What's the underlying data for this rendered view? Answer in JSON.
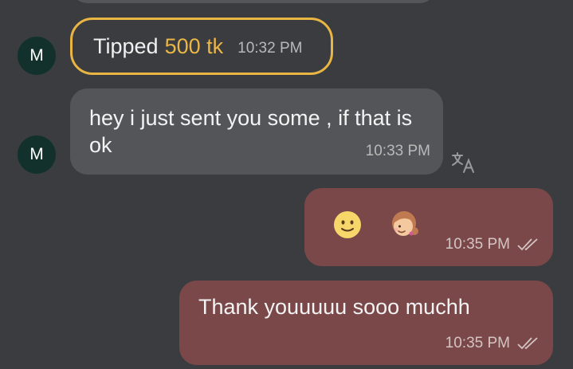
{
  "messages": {
    "tip": {
      "avatar_initial": "M",
      "label": "Tipped",
      "amount": "500 tk",
      "time": "10:32 PM"
    },
    "incoming": {
      "avatar_initial": "M",
      "text": "hey i just sent you some , if that is ok",
      "time": "10:33 PM"
    },
    "emoji_reply": {
      "emojis": [
        "slightly-smiling-face",
        "girl-with-pigtails"
      ],
      "time": "10:35 PM",
      "status": "read"
    },
    "thanks_reply": {
      "text": "Thank youuuuu sooo muchh",
      "time": "10:35 PM",
      "status": "read"
    }
  },
  "icons": {
    "translate": "translate-icon",
    "read_receipt": "double-check-icon"
  },
  "colors": {
    "background": "#3b3c40",
    "incoming_bubble": "#545558",
    "outgoing_bubble": "#7a4849",
    "tip_accent": "#eab646",
    "avatar": "#12312d"
  }
}
